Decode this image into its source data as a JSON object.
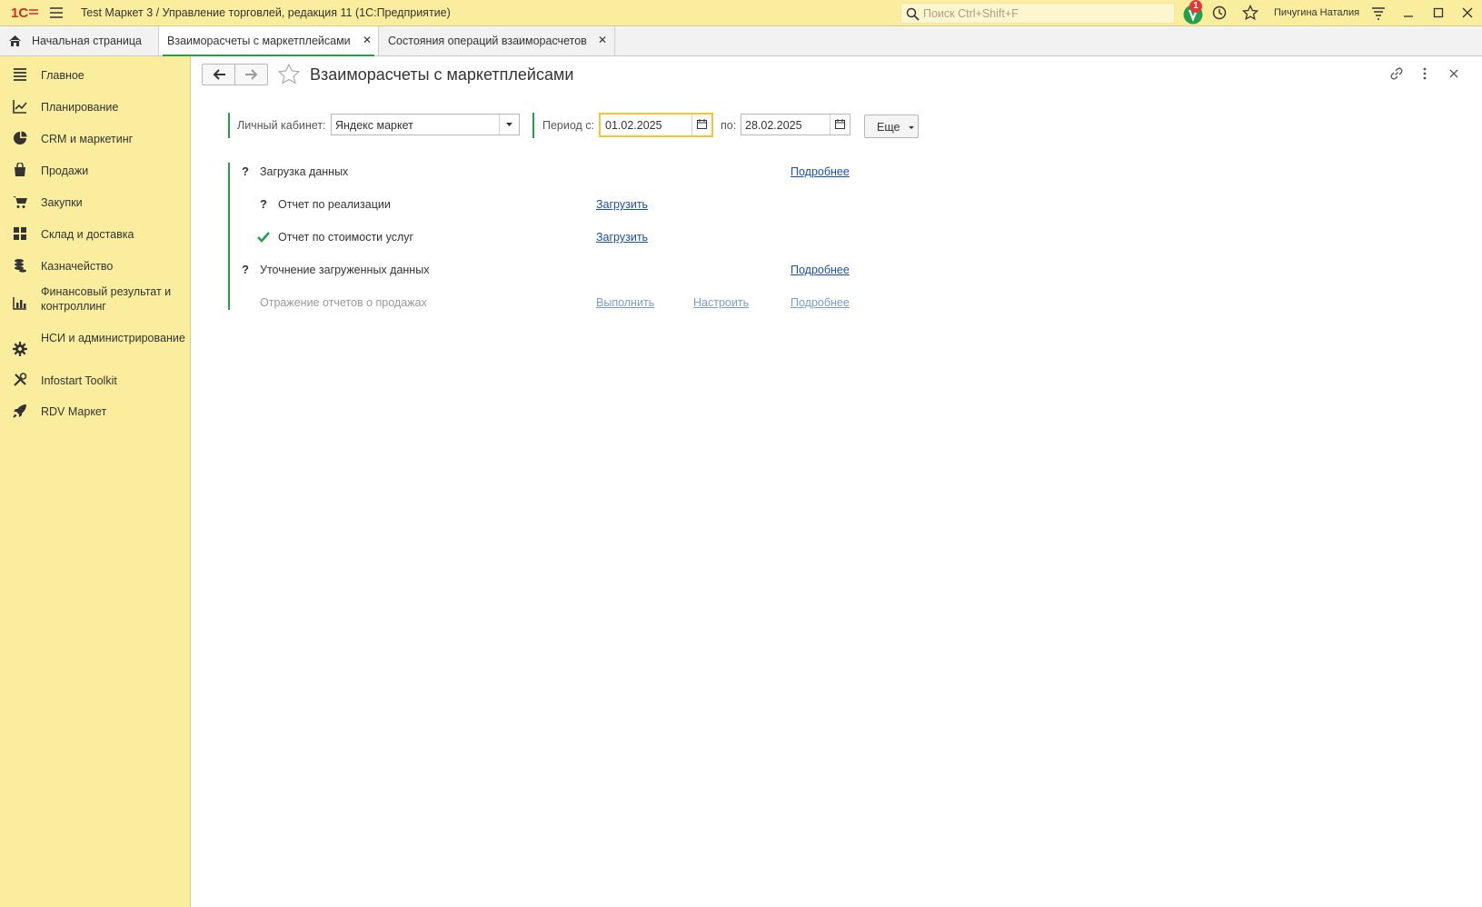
{
  "titlebar": {
    "app_title": "Test Маркет 3 / Управление торговлей, редакция 11  (1С:Предприятие)",
    "search_placeholder": "Поиск Ctrl+Shift+F",
    "notification_count": "1",
    "user_name": "Пичугина Наталия"
  },
  "tabs": [
    {
      "label": "Начальная страница"
    },
    {
      "label": "Взаиморасчеты с маркетплейсами",
      "active": true
    },
    {
      "label": "Состояния операций взаиморасчетов"
    }
  ],
  "sidebar": {
    "items": [
      {
        "label": "Главное",
        "icon": "list-icon"
      },
      {
        "label": "Планирование",
        "icon": "chart-up-icon"
      },
      {
        "label": "CRM и маркетинг",
        "icon": "pie-chart-icon"
      },
      {
        "label": "Продажи",
        "icon": "shopping-bag-icon"
      },
      {
        "label": "Закупки",
        "icon": "cart-icon"
      },
      {
        "label": "Склад и доставка",
        "icon": "warehouse-grid-icon"
      },
      {
        "label": "Казначейство",
        "icon": "coins-icon"
      },
      {
        "label": "Финансовый результат и контроллинг",
        "icon": "bar-chart-icon"
      },
      {
        "label": "НСИ и администрирование",
        "icon": "gear-icon"
      },
      {
        "label": "Infostart Toolkit",
        "icon": "tools-icon"
      },
      {
        "label": "RDV Маркет",
        "icon": "rocket-icon"
      }
    ]
  },
  "page": {
    "title": "Взаиморасчеты с маркетплейсами"
  },
  "filters": {
    "cabinet_label": "Личный кабинет:",
    "cabinet_value": "Яндекс маркет",
    "period_from_label": "Период с:",
    "period_from_value": "01.02.2025",
    "period_to_label": "по:",
    "period_to_value": "28.02.2025",
    "more_label": "Еще"
  },
  "steps": {
    "load": {
      "mark": "?",
      "label": "Загрузка данных",
      "details": "Подробнее"
    },
    "sales_report": {
      "mark": "?",
      "label": "Отчет по реализации",
      "action": "Загрузить"
    },
    "services_report": {
      "mark": "check",
      "label": "Отчет по стоимости услуг",
      "action": "Загрузить"
    },
    "refine": {
      "mark": "?",
      "label": "Уточнение загруженных данных",
      "details": "Подробнее"
    },
    "reflect": {
      "label": "Отражение отчетов о продажах",
      "execute": "Выполнить",
      "configure": "Настроить",
      "details": "Подробнее"
    }
  },
  "colors": {
    "sidebar_bg": "#fbed9e",
    "accent_green": "#25a04a",
    "link_blue": "#1a50a8",
    "focus_yellow": "#f5c430"
  }
}
